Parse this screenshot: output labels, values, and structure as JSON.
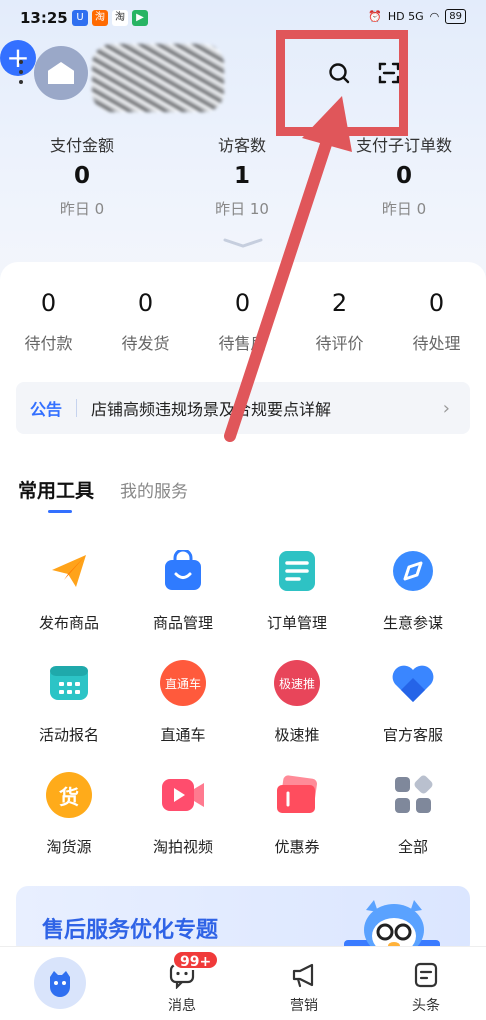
{
  "status_bar": {
    "time": "13:25",
    "battery": "89",
    "network": "HD 5G"
  },
  "header": {
    "add_label": "+"
  },
  "stats": [
    {
      "label": "支付金额",
      "value": "0",
      "prev": "昨日 0"
    },
    {
      "label": "访客数",
      "value": "1",
      "prev": "昨日 10"
    },
    {
      "label": "支付子订单数",
      "value": "0",
      "prev": "昨日 0"
    }
  ],
  "orders": [
    {
      "value": "0",
      "label": "待付款"
    },
    {
      "value": "0",
      "label": "待发货"
    },
    {
      "value": "0",
      "label": "待售后"
    },
    {
      "value": "2",
      "label": "待评价"
    },
    {
      "value": "0",
      "label": "待处理"
    }
  ],
  "notice": {
    "tag": "公告",
    "text": "店铺高频违规场景及合规要点详解"
  },
  "tabs": {
    "active": "常用工具",
    "other": "我的服务"
  },
  "tools": [
    {
      "label": "发布商品",
      "icon": "paper-plane-icon",
      "color": "#ff9f1c"
    },
    {
      "label": "商品管理",
      "icon": "shopping-bag-icon",
      "color": "#2f7bff"
    },
    {
      "label": "订单管理",
      "icon": "document-icon",
      "color": "#2ec2c4"
    },
    {
      "label": "生意参谋",
      "icon": "compass-icon",
      "color": "#3a8bff"
    },
    {
      "label": "活动报名",
      "icon": "calendar-icon",
      "color": "#2cc4c6"
    },
    {
      "label": "直通车",
      "icon": "ztc-logo-icon",
      "color": "#ff5a3c",
      "inner": "直通车"
    },
    {
      "label": "极速推",
      "icon": "jst-logo-icon",
      "color": "#e8455a",
      "inner": "极速推"
    },
    {
      "label": "官方客服",
      "icon": "heart-icon",
      "color": "#3a86ff"
    },
    {
      "label": "淘货源",
      "icon": "huo-logo-icon",
      "color": "#ffab1a",
      "inner": "货"
    },
    {
      "label": "淘拍视频",
      "icon": "video-camera-icon",
      "color": "#ff4d6d"
    },
    {
      "label": "优惠券",
      "icon": "coupon-icon",
      "color": "#ff4d5e"
    },
    {
      "label": "全部",
      "icon": "grid-icon",
      "color": "#8a93a6"
    }
  ],
  "banner": {
    "title": "售后服务优化专题"
  },
  "tabbar": [
    {
      "label": "",
      "icon": "home-icon"
    },
    {
      "label": "消息",
      "icon": "message-icon"
    },
    {
      "label": "营销",
      "icon": "megaphone-icon"
    },
    {
      "label": "头条",
      "icon": "news-icon"
    }
  ],
  "message_badge": "99+",
  "colors": {
    "accent": "#3370ff",
    "annotation": "#e0565a"
  }
}
